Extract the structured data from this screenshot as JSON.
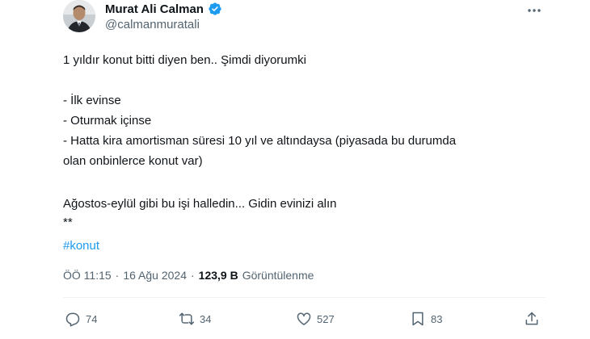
{
  "author": {
    "display_name": "Murat Ali Calman",
    "handle": "@calmanmuratali"
  },
  "tweet": {
    "lines": [
      "1 yıldır konut bitti diyen ben.. Şimdi diyorumki",
      "- İlk evinse",
      "- Oturmak içinse",
      "- Hatta kira amortisman süresi 10 yıl ve altındaysa (piyasada bu durumda",
      "olan onbinlerce konut var)",
      "Ağostos-eylül gibi bu işi halledin... Gidin evinizi alın",
      "**"
    ],
    "hashtag": "#konut"
  },
  "meta": {
    "time": "ÖÖ 11:15",
    "separator": "·",
    "date": "16 Ağu 2024",
    "views_count": "123,9 B",
    "views_label": "Görüntülenme"
  },
  "actions": {
    "replies": "74",
    "reposts": "34",
    "likes": "527",
    "bookmarks": "83"
  },
  "colors": {
    "accent": "#1d9bf0",
    "text": "#0f1419",
    "secondary": "#536471"
  },
  "icons": [
    "verified-badge-icon",
    "more-icon",
    "reply-icon",
    "repost-icon",
    "like-icon",
    "bookmark-icon",
    "share-icon"
  ]
}
